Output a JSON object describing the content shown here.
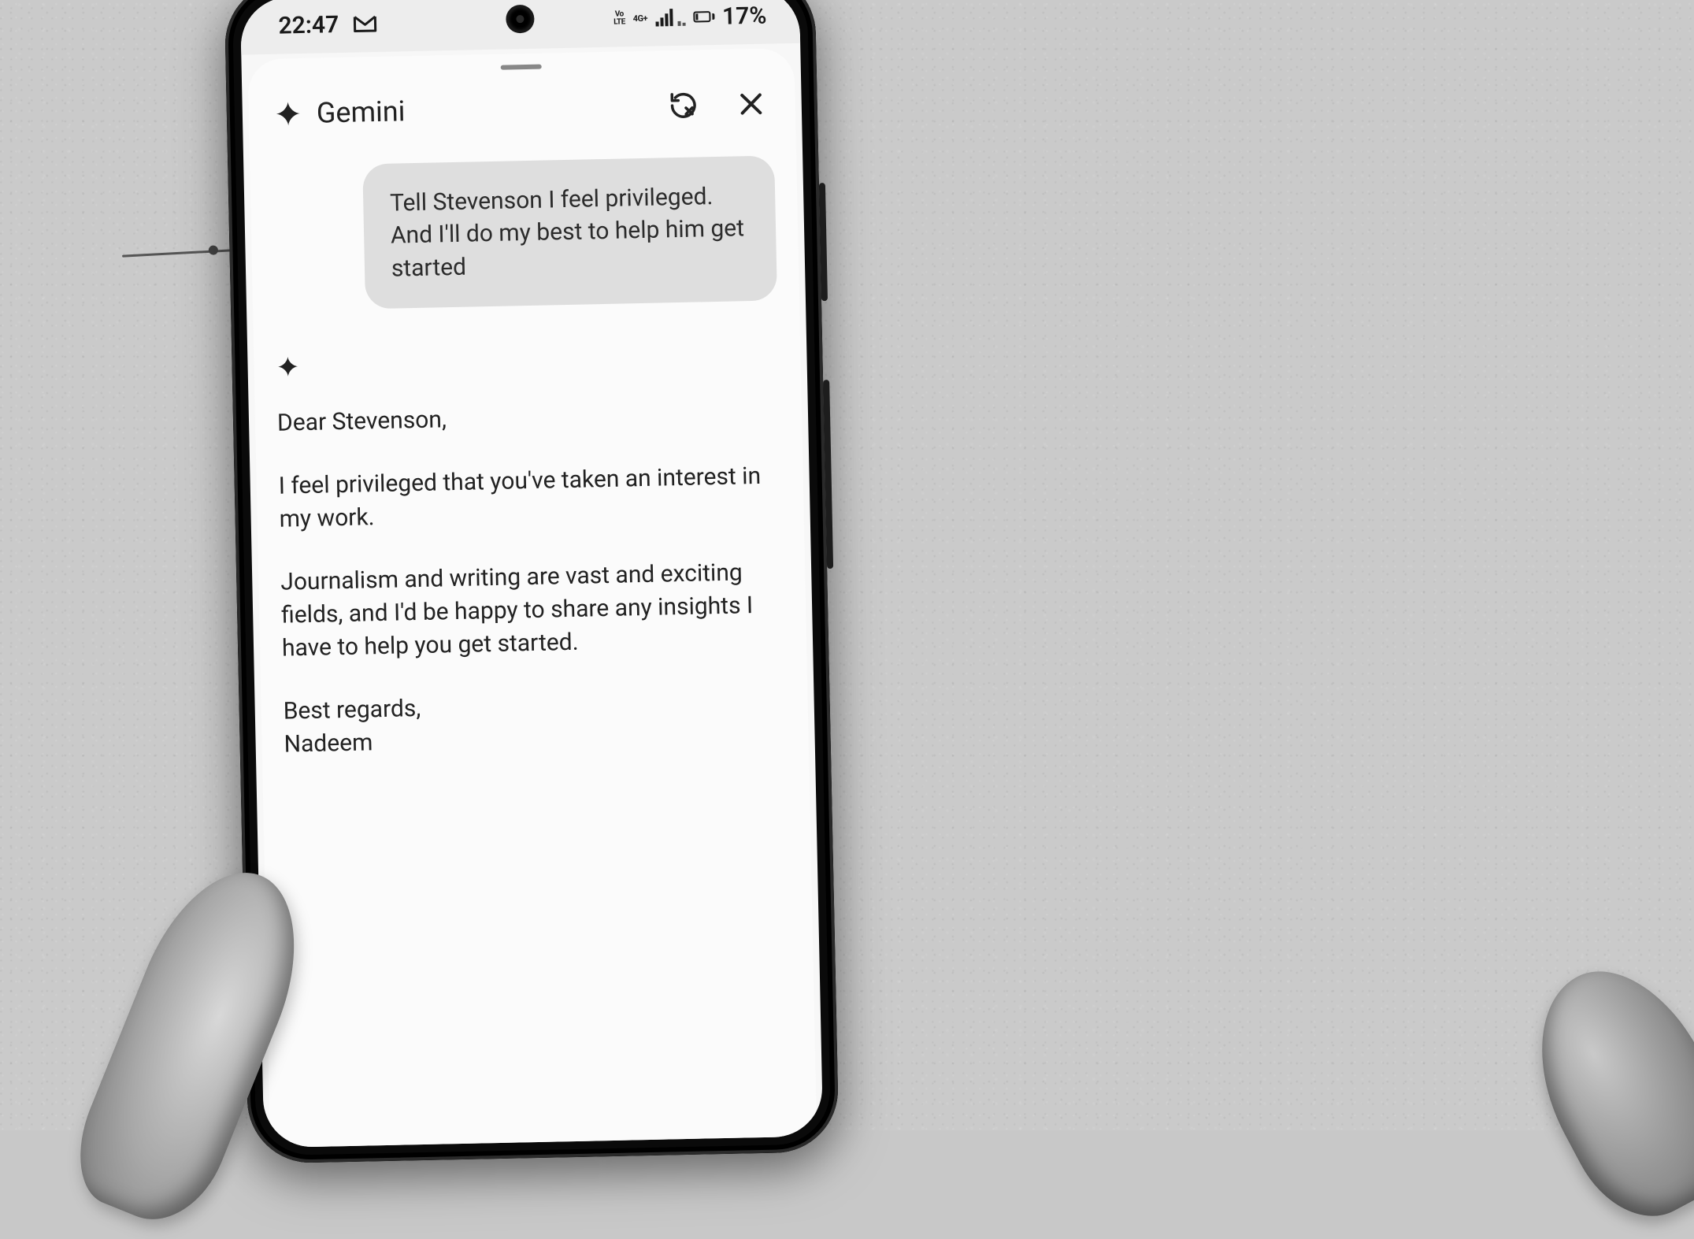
{
  "status_bar": {
    "time": "22:47",
    "volte_label_top": "Vo",
    "volte_label_bottom": "LTE",
    "net_label_top": "4G+",
    "battery_percent": "17%"
  },
  "sheet": {
    "title": "Gemini"
  },
  "user_message": "Tell Stevenson I feel privileged. And I'll do my best to help him get started",
  "reply": {
    "greeting": "Dear Stevenson,",
    "p1": "I feel privileged that you've taken an interest in my work.",
    "p2": "Journalism and writing are vast and exciting fields, and I'd be happy to share any insights I have to help you get started.",
    "signoff": "Best regards,",
    "name": "Nadeem"
  }
}
